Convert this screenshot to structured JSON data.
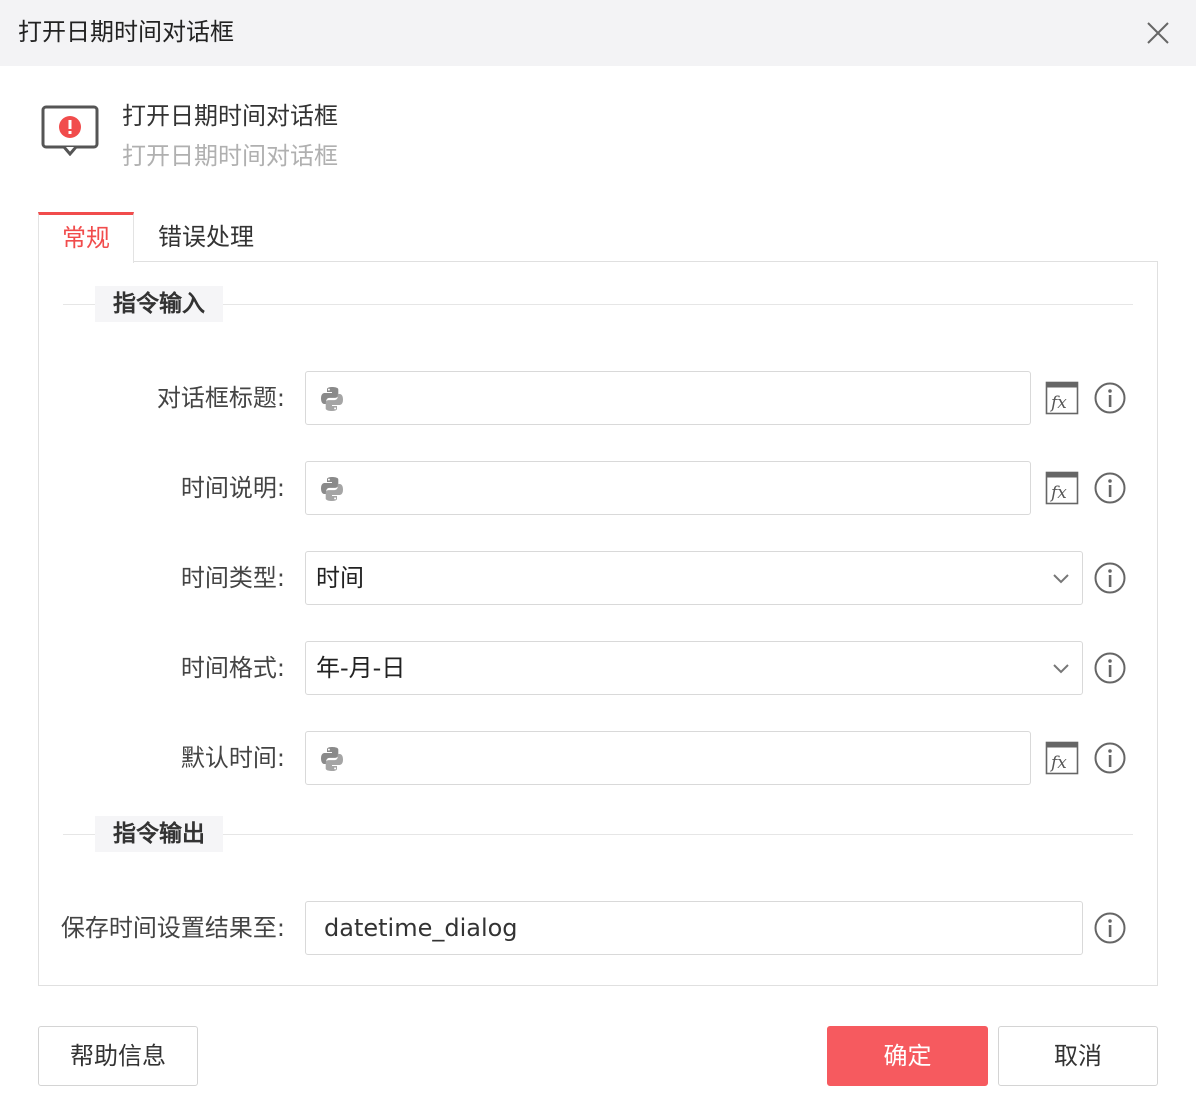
{
  "window": {
    "title": "打开日期时间对话框"
  },
  "header": {
    "name": "打开日期时间对话框",
    "description": "打开日期时间对话框"
  },
  "tabs": [
    {
      "label": "常规"
    },
    {
      "label": "错误处理"
    }
  ],
  "sections": {
    "input": "指令输入",
    "output": "指令输出"
  },
  "fields": {
    "dialog_title": {
      "label": "对话框标题:",
      "value": ""
    },
    "time_desc": {
      "label": "时间说明:",
      "value": ""
    },
    "time_type": {
      "label": "时间类型:",
      "value": "时间"
    },
    "time_format": {
      "label": "时间格式:",
      "value": "年-月-日"
    },
    "default_time": {
      "label": "默认时间:",
      "value": ""
    },
    "save_result": {
      "label": "保存时间设置结果至:",
      "value": "datetime_dialog"
    }
  },
  "buttons": {
    "help": "帮助信息",
    "ok": "确定",
    "cancel": "取消"
  },
  "colors": {
    "accent": "#f14c4c",
    "primary_button": "#f65a5f"
  },
  "icons": [
    "close-icon",
    "alert-message-icon",
    "python-icon",
    "fx-icon",
    "info-icon",
    "chevron-down-icon"
  ]
}
